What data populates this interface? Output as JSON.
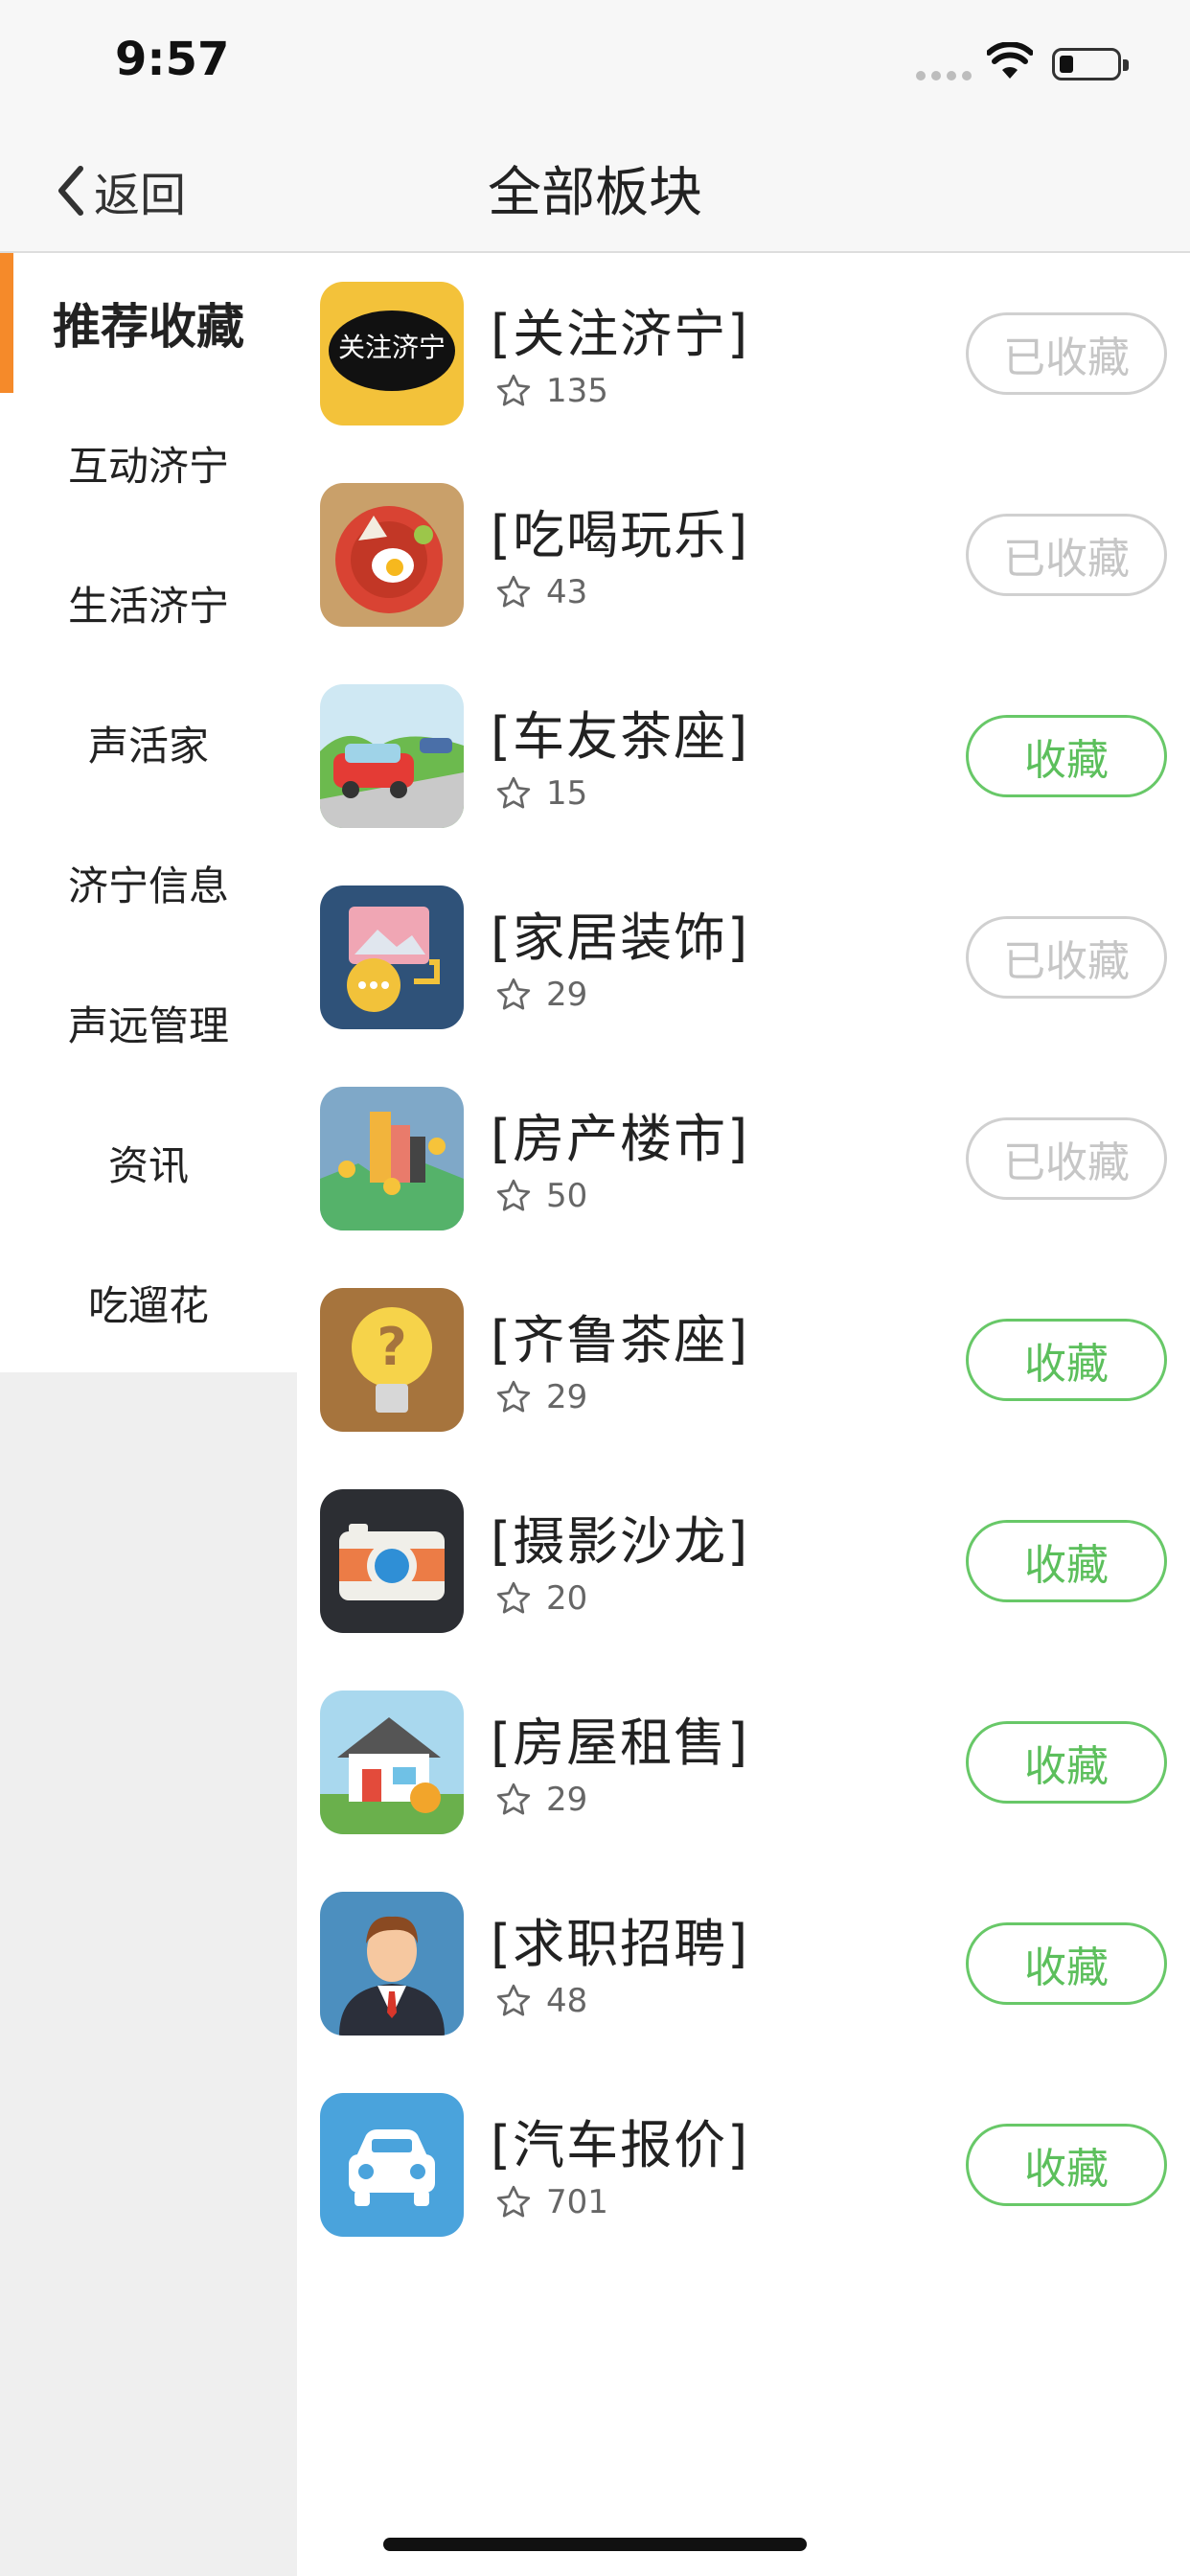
{
  "status_bar": {
    "time": "9:57"
  },
  "nav": {
    "back_label": "返回",
    "title": "全部板块"
  },
  "sidebar": {
    "items": [
      {
        "label": "推荐收藏",
        "active": true
      },
      {
        "label": "互动济宁"
      },
      {
        "label": "生活济宁"
      },
      {
        "label": "声活家"
      },
      {
        "label": "济宁信息"
      },
      {
        "label": "声远管理"
      },
      {
        "label": "资讯"
      },
      {
        "label": "吃遛花"
      }
    ]
  },
  "boards": [
    {
      "name": "[关注济宁]",
      "count": "135",
      "button": "已收藏",
      "collected": true,
      "icon": "guanzhu-jining-logo-icon",
      "icon_text": "关注济宁"
    },
    {
      "name": "[吃喝玩乐]",
      "count": "43",
      "button": "已收藏",
      "collected": true,
      "icon": "food-plate-icon"
    },
    {
      "name": "[车友茶座]",
      "count": "15",
      "button": "收藏",
      "collected": false,
      "icon": "red-car-icon"
    },
    {
      "name": "[家居装饰]",
      "count": "29",
      "button": "已收藏",
      "collected": true,
      "icon": "picture-chat-icon"
    },
    {
      "name": "[房产楼市]",
      "count": "50",
      "button": "已收藏",
      "collected": true,
      "icon": "city-buildings-icon"
    },
    {
      "name": "[齐鲁茶座]",
      "count": "29",
      "button": "收藏",
      "collected": false,
      "icon": "lightbulb-question-icon"
    },
    {
      "name": "[摄影沙龙]",
      "count": "20",
      "button": "收藏",
      "collected": false,
      "icon": "camera-icon"
    },
    {
      "name": "[房屋租售]",
      "count": "29",
      "button": "收藏",
      "collected": false,
      "icon": "house-coin-icon"
    },
    {
      "name": "[求职招聘]",
      "count": "48",
      "button": "收藏",
      "collected": false,
      "icon": "businessman-icon"
    },
    {
      "name": "[汽车报价]",
      "count": "701",
      "button": "收藏",
      "collected": false,
      "icon": "car-front-icon"
    }
  ],
  "colors": {
    "accent_orange": "#f58a2a",
    "collect_green": "#5cbf5c",
    "collected_gray": "#c6c6c6",
    "sidebar_bg": "#efefef"
  }
}
